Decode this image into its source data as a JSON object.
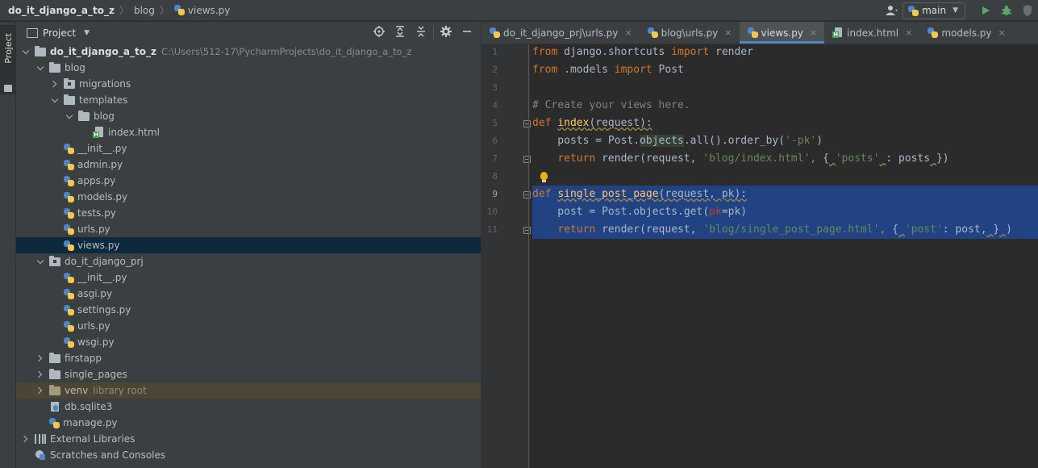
{
  "breadcrumb": {
    "root": "do_it_django_a_to_z",
    "folder": "blog",
    "file": "views.py"
  },
  "toolbar": {
    "run_config": "main",
    "icons": [
      "user-icon",
      "python-icon",
      "run-icon",
      "debug-icon",
      "coverage-icon"
    ]
  },
  "left_strip": {
    "project_tab": "Project"
  },
  "project_panel": {
    "title": "Project",
    "tool_icons": [
      "locate-icon",
      "expand-all-icon",
      "collapse-all-icon",
      "gear-icon",
      "minimize-icon"
    ],
    "tree": [
      {
        "label": "do_it_django_a_to_z",
        "sub": "C:\\Users\\512-17\\PycharmProjects\\do_it_django_a_to_z",
        "indent": 0,
        "chev": "open",
        "icon": "folder",
        "bold": true
      },
      {
        "label": "blog",
        "indent": 1,
        "chev": "open",
        "icon": "folder"
      },
      {
        "label": "migrations",
        "indent": 2,
        "chev": "closed",
        "icon": "package"
      },
      {
        "label": "templates",
        "indent": 2,
        "chev": "open",
        "icon": "folder"
      },
      {
        "label": "blog",
        "indent": 3,
        "chev": "open",
        "icon": "folder"
      },
      {
        "label": "index.html",
        "indent": 4,
        "chev": "none",
        "icon": "html"
      },
      {
        "label": "__init__.py",
        "indent": 2,
        "chev": "none",
        "icon": "python"
      },
      {
        "label": "admin.py",
        "indent": 2,
        "chev": "none",
        "icon": "python"
      },
      {
        "label": "apps.py",
        "indent": 2,
        "chev": "none",
        "icon": "python"
      },
      {
        "label": "models.py",
        "indent": 2,
        "chev": "none",
        "icon": "python"
      },
      {
        "label": "tests.py",
        "indent": 2,
        "chev": "none",
        "icon": "python"
      },
      {
        "label": "urls.py",
        "indent": 2,
        "chev": "none",
        "icon": "python"
      },
      {
        "label": "views.py",
        "indent": 2,
        "chev": "none",
        "icon": "python",
        "selected": true
      },
      {
        "label": "do_it_django_prj",
        "indent": 1,
        "chev": "open",
        "icon": "package"
      },
      {
        "label": "__init__.py",
        "indent": 2,
        "chev": "none",
        "icon": "python"
      },
      {
        "label": "asgi.py",
        "indent": 2,
        "chev": "none",
        "icon": "python"
      },
      {
        "label": "settings.py",
        "indent": 2,
        "chev": "none",
        "icon": "python"
      },
      {
        "label": "urls.py",
        "indent": 2,
        "chev": "none",
        "icon": "python"
      },
      {
        "label": "wsgi.py",
        "indent": 2,
        "chev": "none",
        "icon": "python"
      },
      {
        "label": "firstapp",
        "indent": 1,
        "chev": "closed",
        "icon": "folder"
      },
      {
        "label": "single_pages",
        "indent": 1,
        "chev": "closed",
        "icon": "folder"
      },
      {
        "label": "venv",
        "sub": "library root",
        "indent": 1,
        "chev": "closed",
        "icon": "libfolder",
        "lib": true
      },
      {
        "label": "db.sqlite3",
        "indent": 1,
        "chev": "none",
        "icon": "db"
      },
      {
        "label": "manage.py",
        "indent": 1,
        "chev": "none",
        "icon": "python"
      },
      {
        "label": "External Libraries",
        "indent": 0,
        "chev": "closed",
        "icon": "libraries"
      },
      {
        "label": "Scratches and Consoles",
        "indent": 0,
        "chev": "none",
        "icon": "scratches"
      }
    ]
  },
  "editor": {
    "tabs": [
      {
        "label": "do_it_django_prj\\urls.py",
        "icon": "python",
        "active": false
      },
      {
        "label": "blog\\urls.py",
        "icon": "python",
        "active": false
      },
      {
        "label": "views.py",
        "icon": "python",
        "active": true
      },
      {
        "label": "index.html",
        "icon": "html",
        "active": false
      },
      {
        "label": "models.py",
        "icon": "python",
        "active": false
      }
    ],
    "close_glyph": "×",
    "line_numbers": [
      "1",
      "2",
      "3",
      "4",
      "5",
      "6",
      "7",
      "8",
      "9",
      "10",
      "11"
    ],
    "current_line": "9",
    "code": [
      [
        [
          "kw",
          "from"
        ],
        [
          "",
          "&nbsp;django.shortcuts&nbsp;"
        ],
        [
          "kw",
          "import"
        ],
        [
          "",
          "&nbsp;render"
        ]
      ],
      [
        [
          "kw",
          "from"
        ],
        [
          "",
          "&nbsp;.models&nbsp;"
        ],
        [
          "kw",
          "import"
        ],
        [
          "",
          "&nbsp;Post"
        ]
      ],
      [],
      [
        [
          "cm",
          "#&nbsp;Create&nbsp;your&nbsp;views&nbsp;here."
        ]
      ],
      [
        [
          "kw",
          "def"
        ],
        [
          "",
          "&nbsp;"
        ],
        [
          "fn warn",
          "index"
        ],
        [
          "warn",
          "(request):"
        ]
      ],
      [
        [
          "",
          "&nbsp;&nbsp;&nbsp;&nbsp;posts&nbsp;=&nbsp;Post."
        ],
        [
          "hl",
          "objects"
        ],
        [
          "",
          ".all().order_by("
        ],
        [
          "st",
          "'-pk'"
        ],
        [
          "",
          ")"
        ]
      ],
      [
        [
          "",
          "&nbsp;&nbsp;&nbsp;&nbsp;"
        ],
        [
          "kw",
          "return"
        ],
        [
          "",
          "&nbsp;render(request,&nbsp;"
        ],
        [
          "st",
          "'blog/index.html'"
        ],
        [
          "kw",
          ",&nbsp;"
        ],
        [
          "",
          "{"
        ],
        [
          "warn",
          "&nbsp;"
        ],
        [
          "st",
          "'posts'"
        ],
        [
          "warn",
          "&nbsp;"
        ],
        [
          "",
          ":&nbsp;posts"
        ],
        [
          "warn",
          "&nbsp;"
        ],
        [
          "",
          "})"
        ]
      ],
      [],
      [
        [
          "kw",
          "def"
        ],
        [
          "",
          "&nbsp;"
        ],
        [
          "fn warn",
          "single_post_page"
        ],
        [
          "warn",
          "(request,&nbsp;pk):"
        ]
      ],
      [
        [
          "",
          "&nbsp;&nbsp;&nbsp;&nbsp;post&nbsp;=&nbsp;Post.objects.get("
        ],
        [
          "pa",
          "pk"
        ],
        [
          "",
          "=pk)"
        ]
      ],
      [
        [
          "",
          "&nbsp;&nbsp;&nbsp;&nbsp;"
        ],
        [
          "kw",
          "return"
        ],
        [
          "",
          "&nbsp;render(request,&nbsp;"
        ],
        [
          "st",
          "'blog/single_post_page.html'"
        ],
        [
          "kw",
          ",&nbsp;"
        ],
        [
          "",
          "{"
        ],
        [
          "warn",
          "&nbsp;"
        ],
        [
          "st",
          "'post'"
        ],
        [
          "",
          ":&nbsp;post,"
        ],
        [
          "warn",
          "&nbsp;"
        ],
        [
          "",
          "}"
        ],
        [
          "warn",
          "&nbsp;"
        ],
        [
          "",
          ")"
        ]
      ]
    ]
  }
}
